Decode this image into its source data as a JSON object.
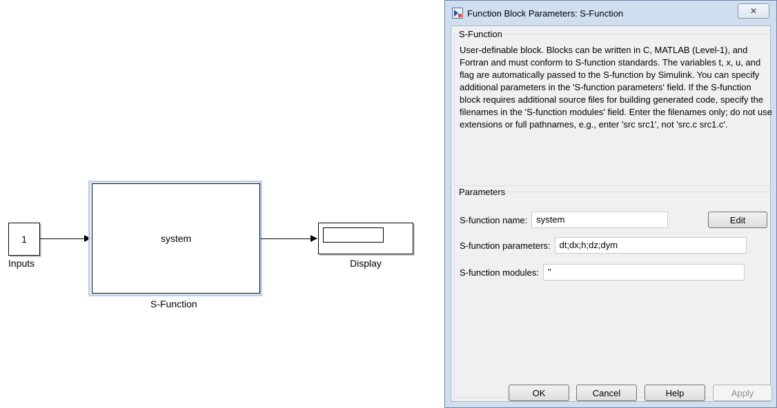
{
  "model": {
    "inputs_value": "1",
    "inputs_label": "Inputs",
    "sfunction_text": "system",
    "sfunction_label": "S-Function",
    "display_label": "Display"
  },
  "dialog": {
    "title": "Function Block Parameters: S-Function",
    "close_glyph": "✕",
    "section_title": "S-Function",
    "description": "User-definable block.  Blocks can be written in C, MATLAB (Level-1), and Fortran and must conform to S-function standards.  The variables t, x, u, and flag are automatically passed to the S-function by Simulink.  You can specify additional parameters in the 'S-function parameters' field. If the S-function block requires additional source files for building generated code, specify the filenames in the 'S-function modules' field. Enter the filenames only; do not use extensions or full pathnames, e.g., enter 'src src1', not 'src.c src1.c'.",
    "parameters_title": "Parameters",
    "name_label": "S-function name:",
    "name_value": "system",
    "edit_label": "Edit",
    "params_label": "S-function parameters:",
    "params_value": "dt;dx;h;dz;dym",
    "modules_label": "S-function modules:",
    "modules_value": "''",
    "ok_label": "OK",
    "cancel_label": "Cancel",
    "help_label": "Help",
    "apply_label": "Apply"
  }
}
